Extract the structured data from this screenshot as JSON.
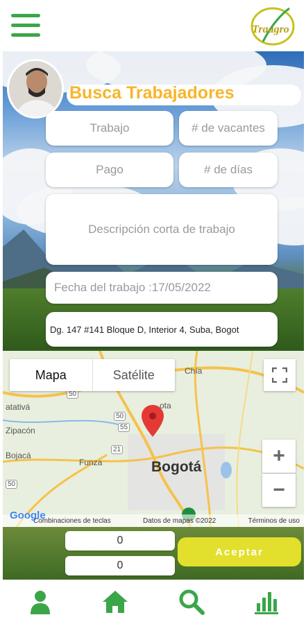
{
  "header": {
    "menu_icon": "hamburger-menu-icon",
    "logo_text": "Traagro"
  },
  "profile": {
    "avatar_icon": "user-avatar-photo"
  },
  "form": {
    "title": "Busca Trabajadores",
    "trabajo_placeholder": "Trabajo",
    "vacantes_placeholder": "# de vacantes",
    "pago_placeholder": "Pago",
    "dias_placeholder": "# de días",
    "descripcion_placeholder": "Descripción corta de trabajo",
    "fecha_value": "Fecha del trabajo :17/05/2022",
    "direccion_value": "Dg. 147 #141 Bloque D, Interior 4, Suba, Bogot"
  },
  "map": {
    "tab_map": "Mapa",
    "tab_satellite": "Satélite",
    "fullscreen_icon": "fullscreen-icon",
    "zoom_in": "+",
    "zoom_out": "−",
    "city_label": "Bogotá",
    "labels": {
      "chia": "Chía",
      "funza": "Funza",
      "bojaca": "Bojacá",
      "zipacon": "Zipacón",
      "cativa": "atativá",
      "cota": "ota"
    },
    "road_badges": [
      "50",
      "50",
      "50",
      "21",
      "55"
    ],
    "google": "Google",
    "attribution": {
      "shortcuts": "Combinaciones de teclas",
      "data": "Datos de mapas ©2022",
      "terms": "Términos de uso"
    }
  },
  "footer_form": {
    "value_1": "0",
    "value_2": "0",
    "accept_label": "Aceptar"
  },
  "navbar": {
    "items": [
      {
        "icon": "person-icon"
      },
      {
        "icon": "home-icon"
      },
      {
        "icon": "search-icon"
      },
      {
        "icon": "bar-chart-icon"
      }
    ]
  },
  "colors": {
    "brand_green": "#3aa648",
    "title_orange": "#f7b52a",
    "accept_yellow": "#e2e02c",
    "pin_red": "#e53935"
  }
}
